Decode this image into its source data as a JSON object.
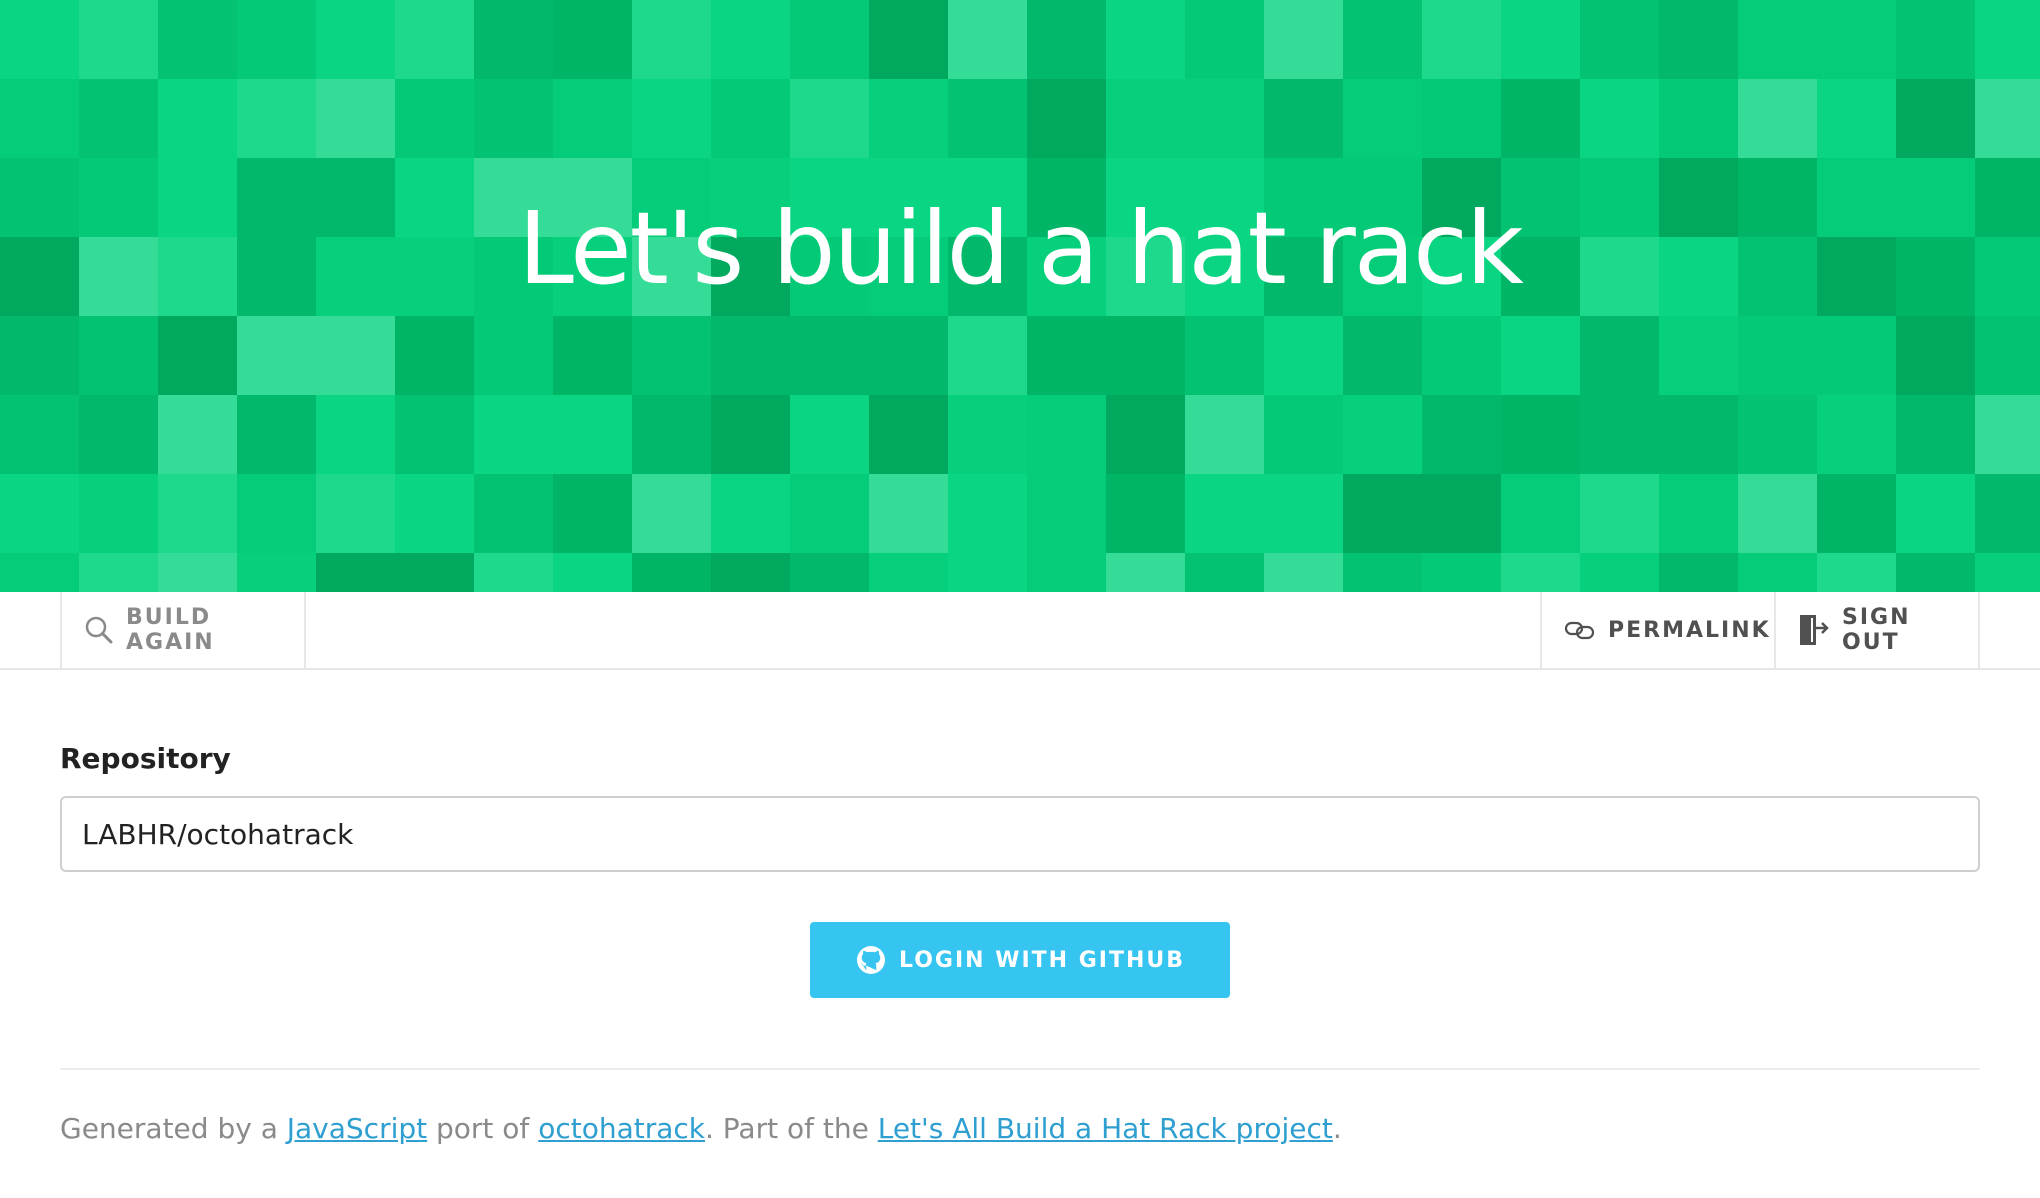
{
  "hero": {
    "title": "Let's build a hat rack",
    "colors": [
      "#02b96b",
      "#03c372",
      "#04ca77",
      "#06d07c",
      "#0ad582",
      "#1ed98c",
      "#34dc97",
      "#01a95f",
      "#00b566",
      "#05cc79"
    ]
  },
  "toolbar": {
    "build_again": {
      "label": "BUILD AGAIN",
      "icon": "search-icon"
    },
    "permalink": {
      "label": "PERMALINK",
      "icon": "link-icon"
    },
    "sign_out": {
      "label": "SIGN OUT",
      "icon": "sign-out-icon"
    }
  },
  "form": {
    "repository_label": "Repository",
    "repository_value": "LABHR/octohatrack",
    "login_button": {
      "label": "LOGIN WITH GITHUB",
      "icon": "github-icon",
      "color": "#36c4f0"
    }
  },
  "footer": {
    "text_1": "Generated by a ",
    "link_1": "JavaScript",
    "text_2": " port of ",
    "link_2": "octohatrack",
    "text_3": ". Part of the ",
    "link_3": "Let's All Build a Hat Rack project",
    "text_4": "."
  }
}
